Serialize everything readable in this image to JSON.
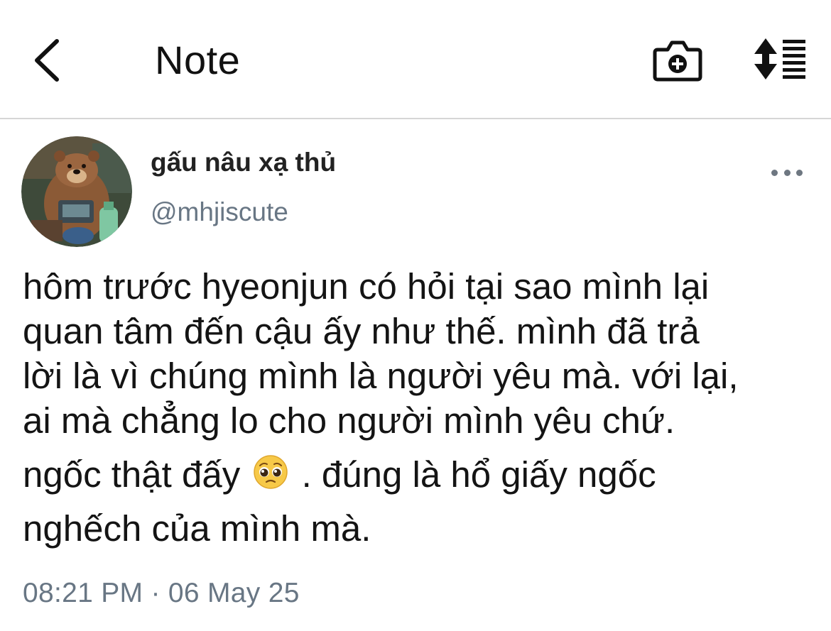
{
  "header": {
    "title": "Note",
    "back_icon": "chevron-left-icon",
    "camera_icon": "camera-plus-icon",
    "sort_icon": "sort-lines-icon"
  },
  "author": {
    "display_name": "gấu nâu xạ thủ",
    "handle": "@mhjiscute",
    "avatar_icon": "bear-avatar"
  },
  "post": {
    "lines": [
      "hôm trước hyeonjun có hỏi tại sao mình lại",
      "quan tâm đến cậu ấy như thế. mình đã trả",
      "lời là vì chúng mình là người yêu mà. với lại,",
      "ai mà chẳng lo cho người mình yêu chứ."
    ],
    "line5_before_emoji": "ngốc thật đấy",
    "emoji": "pleading-face-emoji",
    "line5_after_emoji": ". đúng là hổ giấy ngốc",
    "line6": "nghếch của mình mà."
  },
  "timestamp": "08:21 PM · 06 May 25",
  "colors": {
    "text": "#141414",
    "secondary": "#687684",
    "divider": "#d6d6d6"
  }
}
